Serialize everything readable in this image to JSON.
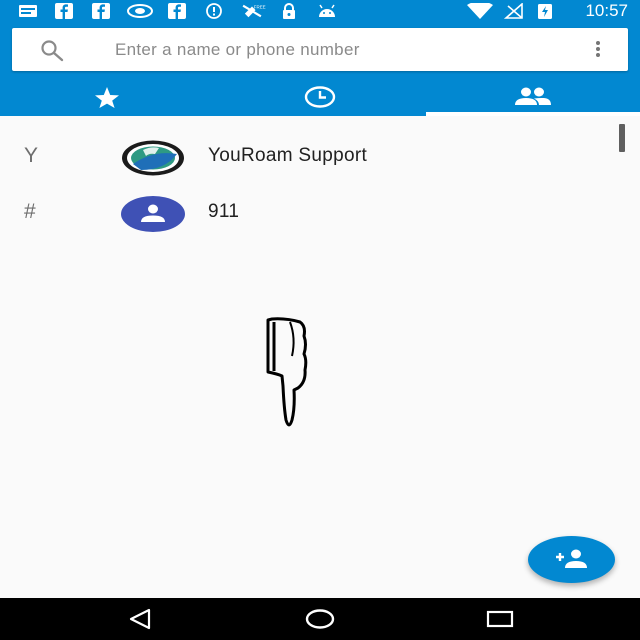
{
  "status_bar": {
    "time": "10:57",
    "icons": [
      "messages-icon",
      "facebook-icon",
      "facebook-icon",
      "nvidia-icon",
      "facebook-icon",
      "data-saver-icon",
      "no-sim-icon",
      "lock-icon",
      "android-icon",
      "wifi-icon",
      "no-signal-icon",
      "battery-charging-icon"
    ]
  },
  "search": {
    "placeholder": "Enter a name or phone number"
  },
  "tabs": [
    {
      "name": "favorites",
      "icon": "star-icon"
    },
    {
      "name": "recents",
      "icon": "clock-icon"
    },
    {
      "name": "contacts",
      "icon": "people-icon",
      "selected": true
    }
  ],
  "contacts": [
    {
      "letter": "Y",
      "name": "YouRoam Support",
      "avatar": "youroam-logo"
    },
    {
      "letter": "#",
      "name": "911",
      "avatar": "default-person"
    }
  ],
  "fab": {
    "icon": "add-contact-icon"
  },
  "nav": [
    "back-icon",
    "home-icon",
    "recents-icon"
  ],
  "colors": {
    "primary": "#0288d1",
    "avatar_default": "#3f51b5",
    "background": "#fafafa"
  }
}
